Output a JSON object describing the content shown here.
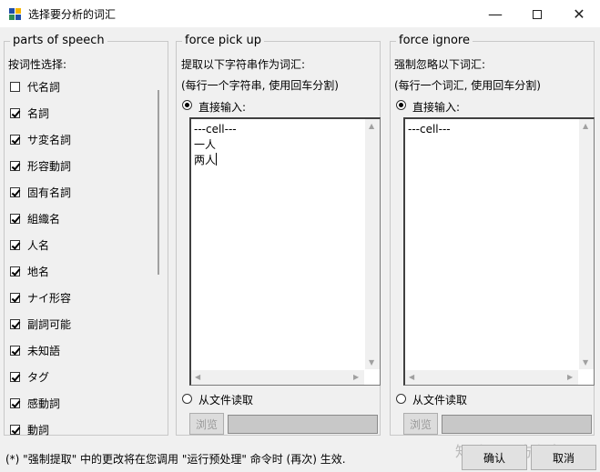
{
  "window": {
    "title": "选择要分析的词汇",
    "minimize_glyph": "—",
    "close_glyph": "✕"
  },
  "pos_panel": {
    "legend": "parts of speech",
    "prompt": "按词性选择:",
    "items": [
      {
        "label": "代名詞",
        "checked": false
      },
      {
        "label": "名詞",
        "checked": true
      },
      {
        "label": "サ変名詞",
        "checked": true
      },
      {
        "label": "形容動詞",
        "checked": true
      },
      {
        "label": "固有名詞",
        "checked": true
      },
      {
        "label": "組織名",
        "checked": true
      },
      {
        "label": "人名",
        "checked": true
      },
      {
        "label": "地名",
        "checked": true
      },
      {
        "label": "ナイ形容",
        "checked": true
      },
      {
        "label": "副詞可能",
        "checked": true
      },
      {
        "label": "未知語",
        "checked": true
      },
      {
        "label": "タグ",
        "checked": true
      },
      {
        "label": "感動詞",
        "checked": true
      },
      {
        "label": "動詞",
        "checked": true
      }
    ]
  },
  "force_pick": {
    "legend": "force pick up",
    "line1": "提取以下字符串作为词汇:",
    "line2": "(每行一个字符串, 使用回车分割)",
    "direct_input": "直接输入:",
    "text_lines": [
      "---cell---",
      "一人",
      "两人"
    ],
    "from_file": "从文件读取",
    "browse": "浏览"
  },
  "force_ignore": {
    "legend": "force ignore",
    "line1": "强制忽略以下词汇:",
    "line2": "(每行一个词汇, 使用回车分割)",
    "direct_input": "直接输入:",
    "text_lines": [
      "---cell---"
    ],
    "from_file": "从文件读取",
    "browse": "浏览"
  },
  "status_text": "(*) \"强制提取\" 中的更改将在您调用 \"运行预处理\" 命令时 (再次) 生效.",
  "buttons": {
    "ok": "确认",
    "cancel": "取消"
  },
  "watermark": "知乎 @平方和寒"
}
